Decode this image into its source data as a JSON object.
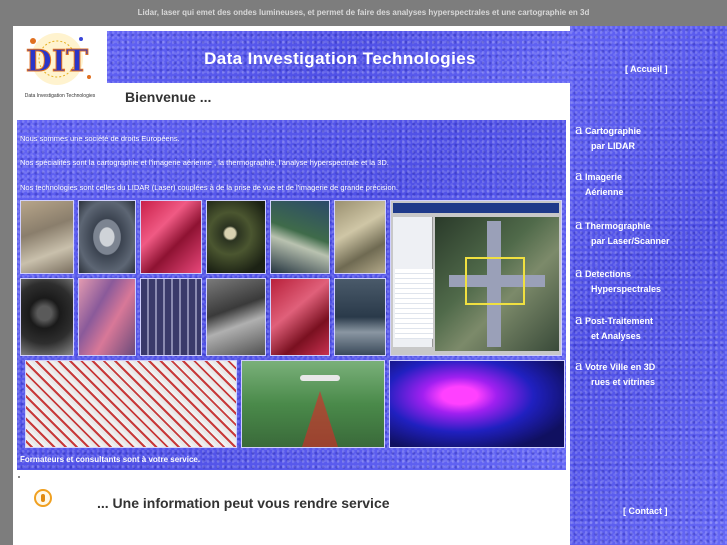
{
  "top_banner": "Lidar, laser qui emet des ondes lumineuses, et permet de faire des analyses hyperspectrales et une cartographie en 3d",
  "logo": {
    "letters": "DIT",
    "caption": "Data Investigation Technologies"
  },
  "header": {
    "title": "Data  Investigation  Technologies"
  },
  "welcome": "Bienvenue ...",
  "intro": {
    "line1": "Nous sommes une société de droits Européens.",
    "line2": "Nos spécialités sont la cartographie et l'imagerie aérienne , la thermographie, l'analyse hyperspectrale et la 3D.",
    "line3": "Nos technologies sont celles du LIDAR (Laser) couplées à de la prise de vue et de l'imagerie de grande précision.",
    "footer": "Formateurs et consultants sont à votre service."
  },
  "info_line": "... Une information peut vous rendre service",
  "sidebar": {
    "accueil": "[ Accueil ]",
    "contact": "[ Contact ]",
    "bullet": "a",
    "items": [
      {
        "line1": "Cartographie",
        "line2": "par  LIDAR"
      },
      {
        "line1": "Imagerie",
        "line2": "Aérienne"
      },
      {
        "line1": "Thermographie",
        "line2": "par Laser/Scanner"
      },
      {
        "line1": "Detections",
        "line2": "Hyperspectrales"
      },
      {
        "line1": "Post-Traitement",
        "line2": "et Analyses"
      },
      {
        "line1": "Votre Ville en 3D",
        "line2": "rues et vitrines"
      }
    ]
  },
  "colors": {
    "page_bg": "#7d7d7d",
    "panel_blue": "#5a5cf0",
    "text_dark": "#333333",
    "icon_orange": "#f0a020"
  },
  "gallery": [
    "aerial-urban-photo",
    "stadium-aerial-photo",
    "red-infrared-aerial-photo",
    "dark-terrain-photo",
    "satellite-coast-photo",
    "ruins-aerial-photo",
    "gis-software-screenshot",
    "lidar-sensor-device-photo",
    "pink-infrared-fields-photo",
    "city-grid-aerial-photo",
    "urban-3d-aerial-photo",
    "red-urban-photo",
    "harbor-aerial-photo",
    "building-footprint-map",
    "lidar-aircraft-scan-illustration",
    "thermal-hyperspectral-image"
  ]
}
